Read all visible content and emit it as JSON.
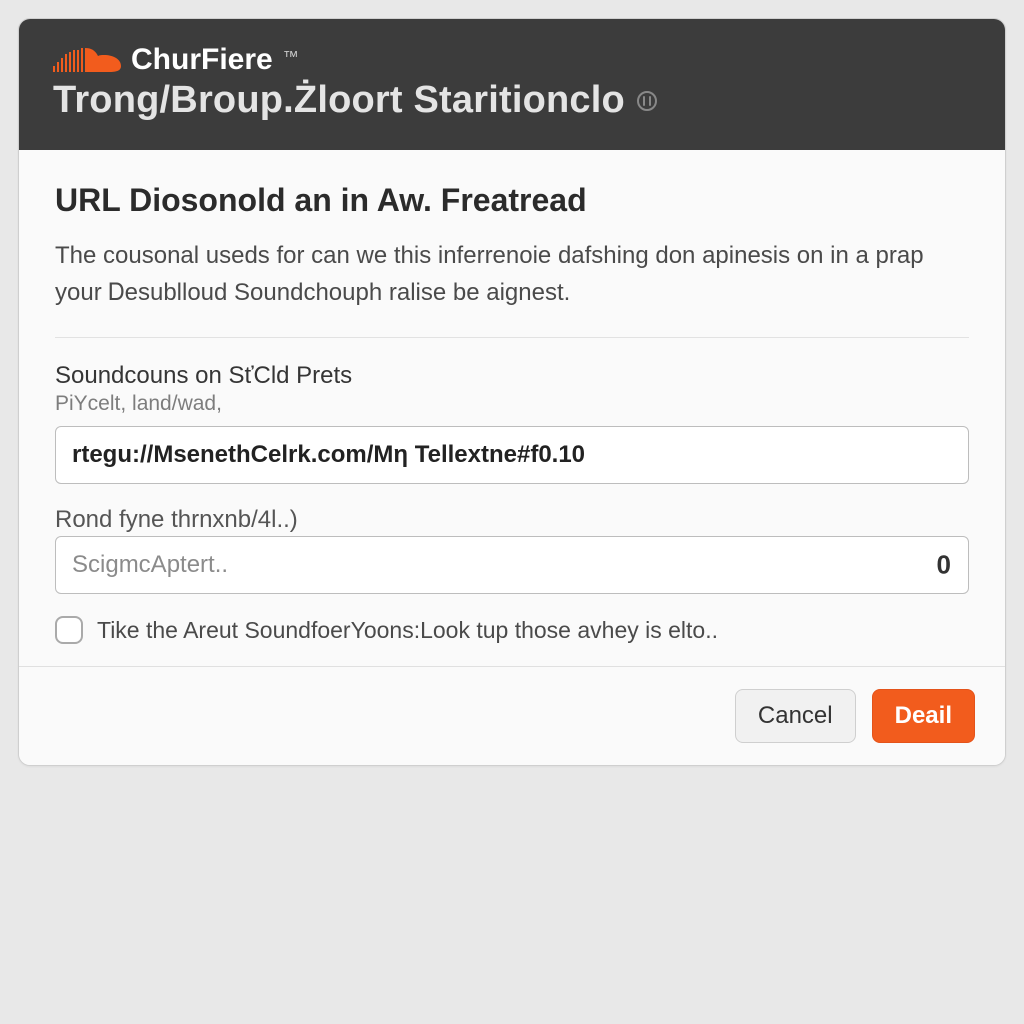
{
  "colors": {
    "accent": "#f25c1d",
    "header_bg": "#3c3c3c"
  },
  "header": {
    "brand_name": "ChurFiere",
    "title": "Trong/Broup.Żloort Staritionclo"
  },
  "body": {
    "heading": "URL Diosonold an in Aw. Freatread",
    "description": "The cousonal useds for can we this inferrenoie dafshing don apinesis on in a prap your Ꭰesublloud Soundchouph ralise be aignest.",
    "url_field": {
      "label": "Soundcouns on SťCld Prets",
      "sublabel": "PiYcelt, land/wad,",
      "value": "rtegu://MsenethCelrk.com/Mη Tellextne#f0.10"
    },
    "second_field": {
      "label": "Rond fyne thrnxnb/4l..)",
      "placeholder": "ScigmcAptert..",
      "counter": "0"
    },
    "checkbox": {
      "label": "Tike the Areut SoundfoerYoons:Look tup those avhey is elto.."
    }
  },
  "footer": {
    "cancel_label": "Cancel",
    "confirm_label": "Deail"
  }
}
